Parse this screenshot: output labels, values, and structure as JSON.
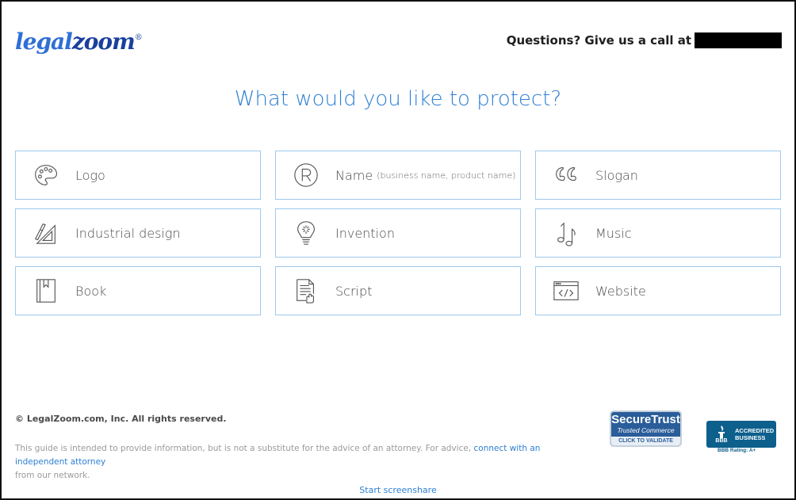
{
  "header": {
    "logo_legal": "legal",
    "logo_zoom": "zoom",
    "logo_reg": "®",
    "call_text": "Questions? Give us a call at"
  },
  "main": {
    "heading": "What would you like to protect?",
    "options": [
      {
        "label": "Logo",
        "sub": "",
        "icon": "palette-icon"
      },
      {
        "label": "Name",
        "sub": "(business name, product name)",
        "icon": "registered-trademark-icon"
      },
      {
        "label": "Slogan",
        "sub": "",
        "icon": "quote-icon"
      },
      {
        "label": "Industrial design",
        "sub": "",
        "icon": "drafting-triangle-icon"
      },
      {
        "label": "Invention",
        "sub": "",
        "icon": "lightbulb-icon"
      },
      {
        "label": "Music",
        "sub": "",
        "icon": "music-notes-icon"
      },
      {
        "label": "Book",
        "sub": "",
        "icon": "book-icon"
      },
      {
        "label": "Script",
        "sub": "",
        "icon": "script-document-icon"
      },
      {
        "label": "Website",
        "sub": "",
        "icon": "browser-code-icon"
      }
    ]
  },
  "footer": {
    "copyright": "© LegalZoom.com, Inc. All rights reserved.",
    "disclaimer_before": "This guide is intended to provide information, but is not a substitute for the advice of an attorney. For advice,",
    "disclaimer_link": "connect with an independent attorney",
    "disclaimer_after": "from our network.",
    "securetrust_title": "SecureTrust",
    "securetrust_sub": "Trusted Commerce",
    "securetrust_cta": "CLICK TO VALIDATE",
    "bbb_mark": "BBB",
    "bbb_line1": "ACCREDITED",
    "bbb_line2": "BUSINESS",
    "bbb_rating": "BBB Rating: A+",
    "screenshare": "Start screenshare"
  },
  "colors": {
    "accent": "#2d7fd4",
    "card_border": "#9ec9ef",
    "logo_light": "#2f6fd6",
    "logo_dark": "#1a3f9e"
  }
}
